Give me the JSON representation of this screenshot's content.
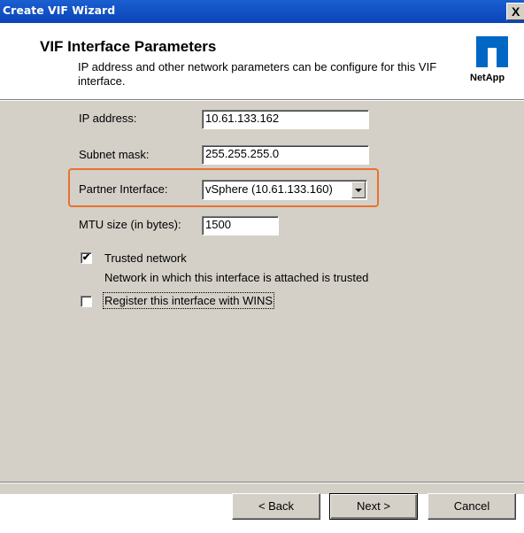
{
  "window": {
    "title": "Create VIF Wizard",
    "close_glyph": "X"
  },
  "header": {
    "heading": "VIF Interface Parameters",
    "description": "IP address and other network parameters can be configure for this VIF interface.",
    "logo_text": "NetApp"
  },
  "form": {
    "ip_label": "IP address:",
    "ip_value": "10.61.133.162",
    "subnet_label": "Subnet mask:",
    "subnet_value": "255.255.255.0",
    "partner_label": "Partner Interface:",
    "partner_value": "vSphere (10.61.133.160)",
    "mtu_label": "MTU size (in bytes):",
    "mtu_value": "1500",
    "trusted_label": "Trusted network",
    "trusted_checked": true,
    "trusted_desc": "Network in which this interface is attached is trusted",
    "wins_label": "Register this interface with WINS",
    "wins_checked": false
  },
  "footer": {
    "back_label": "< Back",
    "next_label": "Next >",
    "cancel_label": "Cancel"
  },
  "colors": {
    "titlebar": "#0a45b8",
    "highlight": "#e8722d",
    "logo": "#0067c5",
    "body": "#d4d0c8"
  }
}
